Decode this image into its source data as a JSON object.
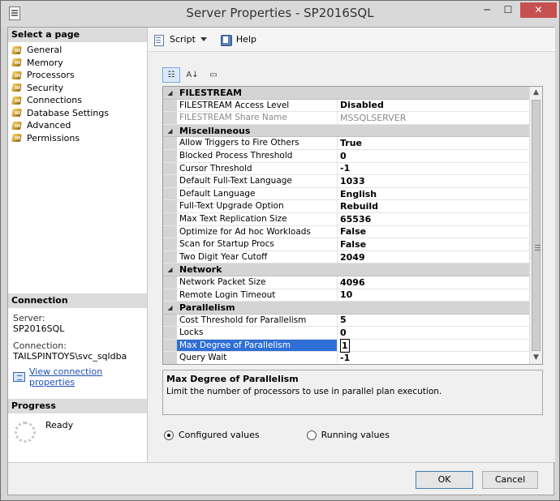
{
  "window": {
    "title": "Server Properties - SP2016SQL",
    "min_glyph": "─",
    "max_glyph": "☐",
    "close_glyph": "✕"
  },
  "left": {
    "select_page_heading": "Select a page",
    "pages": [
      "General",
      "Memory",
      "Processors",
      "Security",
      "Connections",
      "Database Settings",
      "Advanced",
      "Permissions"
    ],
    "connection_heading": "Connection",
    "server_label": "Server:",
    "server_value": "SP2016SQL",
    "connection_label": "Connection:",
    "connection_value": "TAILSPINTOYS\\svc_sqldba",
    "view_link": "View connection properties",
    "progress_heading": "Progress",
    "progress_status": "Ready"
  },
  "toolbar": {
    "script_label": "Script",
    "help_label": "Help"
  },
  "grid": {
    "categories": [
      {
        "name": "FILESTREAM",
        "rows": [
          {
            "name": "FILESTREAM Access Level",
            "value": "Disabled"
          },
          {
            "name": "FILESTREAM Share Name",
            "value": "MSSQLSERVER"
          }
        ]
      },
      {
        "name": "Miscellaneous",
        "rows": [
          {
            "name": "Allow Triggers to Fire Others",
            "value": "True"
          },
          {
            "name": "Blocked Process Threshold",
            "value": "0"
          },
          {
            "name": "Cursor Threshold",
            "value": "-1"
          },
          {
            "name": "Default Full-Text Language",
            "value": "1033"
          },
          {
            "name": "Default Language",
            "value": "English"
          },
          {
            "name": "Full-Text Upgrade Option",
            "value": "Rebuild"
          },
          {
            "name": "Max Text Replication Size",
            "value": "65536"
          },
          {
            "name": "Optimize for Ad hoc Workloads",
            "value": "False"
          },
          {
            "name": "Scan for Startup Procs",
            "value": "False"
          },
          {
            "name": "Two Digit Year Cutoff",
            "value": "2049"
          }
        ]
      },
      {
        "name": "Network",
        "rows": [
          {
            "name": "Network Packet Size",
            "value": "4096"
          },
          {
            "name": "Remote Login Timeout",
            "value": "10"
          }
        ]
      },
      {
        "name": "Parallelism",
        "rows": [
          {
            "name": "Cost Threshold for Parallelism",
            "value": "5"
          },
          {
            "name": "Locks",
            "value": "0"
          },
          {
            "name": "Max Degree of Parallelism",
            "value": "1"
          },
          {
            "name": "Query Wait",
            "value": "-1"
          }
        ]
      }
    ]
  },
  "description": {
    "title": "Max Degree of Parallelism",
    "text": "Limit the number of processors to use in parallel plan execution."
  },
  "radios": {
    "configured": "Configured values",
    "running": "Running values",
    "selected": "configured"
  },
  "buttons": {
    "ok": "OK",
    "cancel": "Cancel"
  }
}
